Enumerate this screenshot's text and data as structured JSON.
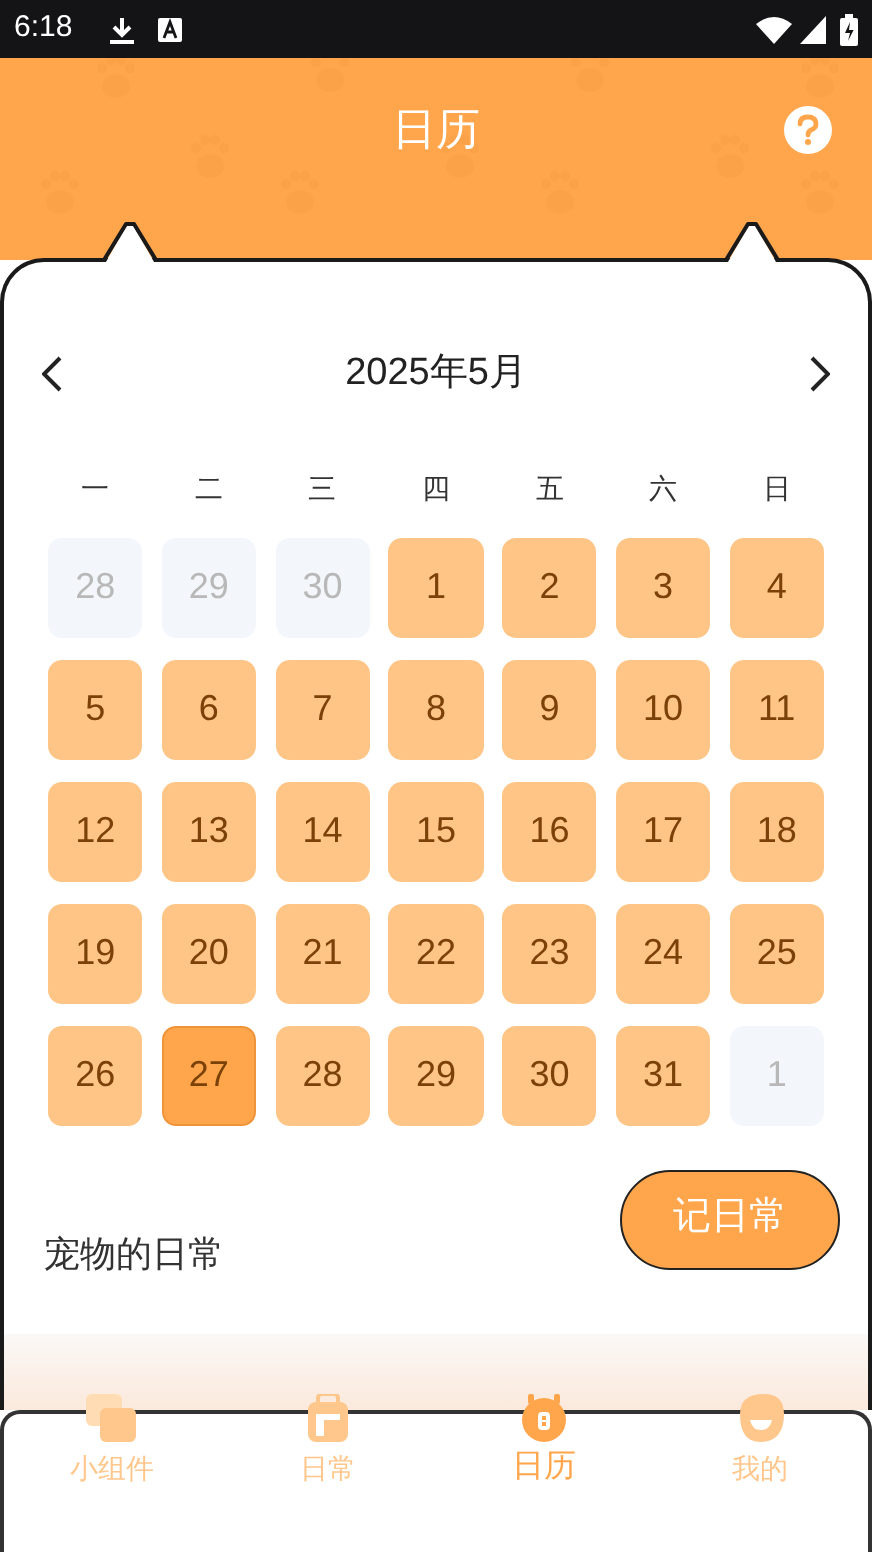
{
  "status_bar": {
    "time": "6:18"
  },
  "header": {
    "title": "日历"
  },
  "calendar": {
    "month_label": "2025年5月",
    "weekdays": [
      "一",
      "二",
      "三",
      "四",
      "五",
      "六",
      "日"
    ],
    "days": [
      {
        "label": "28",
        "in_month": false,
        "selected": false
      },
      {
        "label": "29",
        "in_month": false,
        "selected": false
      },
      {
        "label": "30",
        "in_month": false,
        "selected": false
      },
      {
        "label": "1",
        "in_month": true,
        "selected": false
      },
      {
        "label": "2",
        "in_month": true,
        "selected": false
      },
      {
        "label": "3",
        "in_month": true,
        "selected": false
      },
      {
        "label": "4",
        "in_month": true,
        "selected": false
      },
      {
        "label": "5",
        "in_month": true,
        "selected": false
      },
      {
        "label": "6",
        "in_month": true,
        "selected": false
      },
      {
        "label": "7",
        "in_month": true,
        "selected": false
      },
      {
        "label": "8",
        "in_month": true,
        "selected": false
      },
      {
        "label": "9",
        "in_month": true,
        "selected": false
      },
      {
        "label": "10",
        "in_month": true,
        "selected": false
      },
      {
        "label": "11",
        "in_month": true,
        "selected": false
      },
      {
        "label": "12",
        "in_month": true,
        "selected": false
      },
      {
        "label": "13",
        "in_month": true,
        "selected": false
      },
      {
        "label": "14",
        "in_month": true,
        "selected": false
      },
      {
        "label": "15",
        "in_month": true,
        "selected": false
      },
      {
        "label": "16",
        "in_month": true,
        "selected": false
      },
      {
        "label": "17",
        "in_month": true,
        "selected": false
      },
      {
        "label": "18",
        "in_month": true,
        "selected": false
      },
      {
        "label": "19",
        "in_month": true,
        "selected": false
      },
      {
        "label": "20",
        "in_month": true,
        "selected": false
      },
      {
        "label": "21",
        "in_month": true,
        "selected": false
      },
      {
        "label": "22",
        "in_month": true,
        "selected": false
      },
      {
        "label": "23",
        "in_month": true,
        "selected": false
      },
      {
        "label": "24",
        "in_month": true,
        "selected": false
      },
      {
        "label": "25",
        "in_month": true,
        "selected": false
      },
      {
        "label": "26",
        "in_month": true,
        "selected": false
      },
      {
        "label": "27",
        "in_month": true,
        "selected": true
      },
      {
        "label": "28",
        "in_month": true,
        "selected": false
      },
      {
        "label": "29",
        "in_month": true,
        "selected": false
      },
      {
        "label": "30",
        "in_month": true,
        "selected": false
      },
      {
        "label": "31",
        "in_month": true,
        "selected": false
      },
      {
        "label": "1",
        "in_month": false,
        "selected": false
      }
    ]
  },
  "daily": {
    "title": "宠物的日常",
    "button": "记日常"
  },
  "nav": [
    {
      "label": "小组件",
      "kind": "widgets",
      "selected": false
    },
    {
      "label": "日常",
      "kind": "daily",
      "selected": false
    },
    {
      "label": "日历",
      "kind": "calendar",
      "selected": true
    },
    {
      "label": "我的",
      "kind": "profile",
      "selected": false
    }
  ]
}
